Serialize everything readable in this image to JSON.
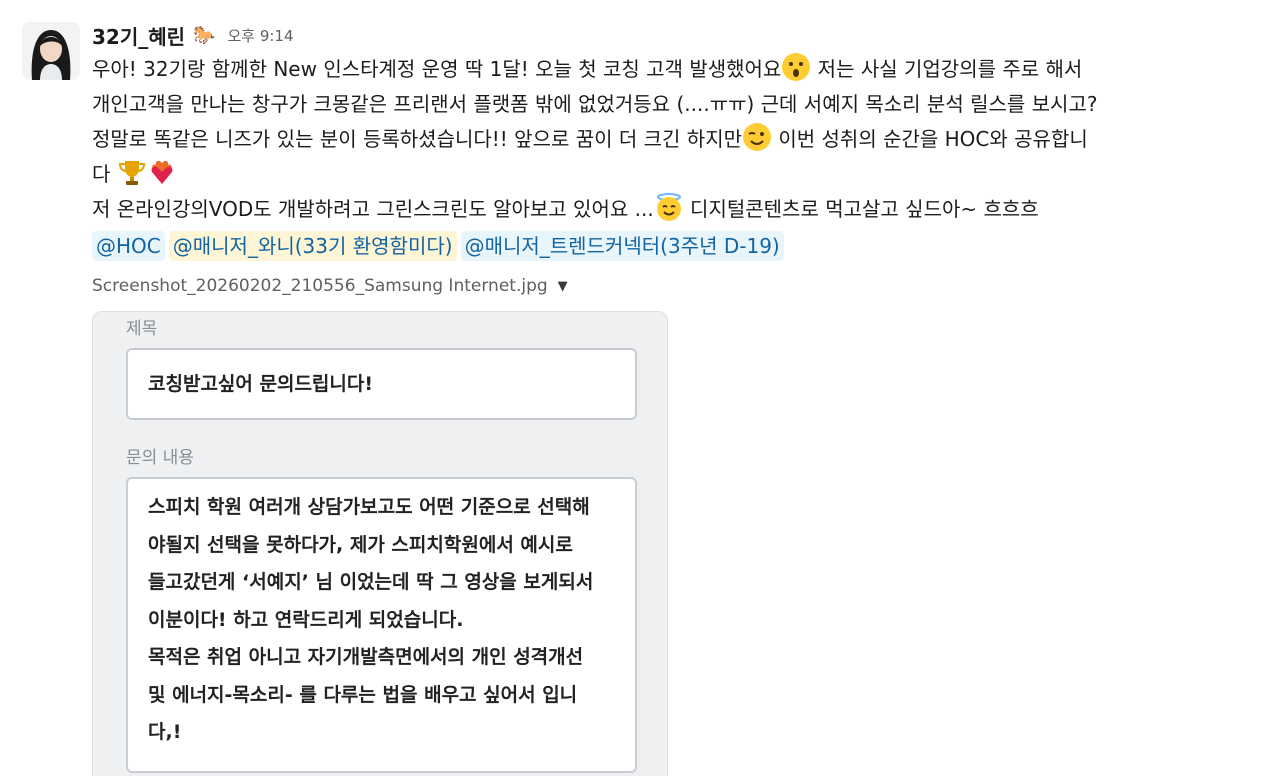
{
  "message": {
    "sender": "32기_혜린",
    "sender_icon": "horse-icon",
    "time": "오후 9:14",
    "lines": [
      [
        "우아! 32기랑 함께한 New 인스타계정 운영 딱 1달! 오늘 첫 코칭 고객 발생했어요",
        " 저는 사실 기업강의를 주로 해서"
      ],
      [
        "개인고객을 만나는 창구가 크몽같은 프리랜서 플랫폼 밖에 없었거등요 (....ㅠㅠ) 근데 서예지 목소리 분석 릴스를 보시고?"
      ],
      [
        "정말로 똑같은 니즈가 있는 분이 등록하셨습니다!! 앞으로 꿈이 더 크긴 하지만",
        " 이번 성취의 순간을 HOC와 공유합니"
      ],
      [
        "다 "
      ],
      [
        "저 온라인강의VOD도 개발하려고 그린스크린도 알아보고 있어요 ...",
        " 디지털콘텐츠로 먹고살고 싶드아~ 흐흐흐"
      ]
    ],
    "mentions": [
      "@HOC",
      "@매니저_와니(33기 환영함미다)",
      "@매니저_트렌드커넥터(3주년 D-19)"
    ]
  },
  "attachment": {
    "file_name": "Screenshot_20260202_210556_Samsung Internet.jpg",
    "caret": "▼",
    "form": {
      "title_label": "제목",
      "title_value": "코칭받고싶어 문의드립니다!",
      "content_label": "문의 내용",
      "content_lines": [
        "스피치 학원 여러개 상담가보고도 어떤 기준으로 선택해",
        "야될지 선택을 못하다가, 제가 스피치학원에서 예시로",
        "들고갔던게 ‘서예지’ 님 이었는데 딱 그 영상을 보게되서",
        "이분이다! 하고 연락드리게 되었습니다.",
        "목적은 취업 아니고 자기개발측면에서의 개인 성격개선",
        "및 에너지-목소리- 를 다루는 법을 배우고 싶어서 입니",
        "다,!"
      ]
    }
  }
}
